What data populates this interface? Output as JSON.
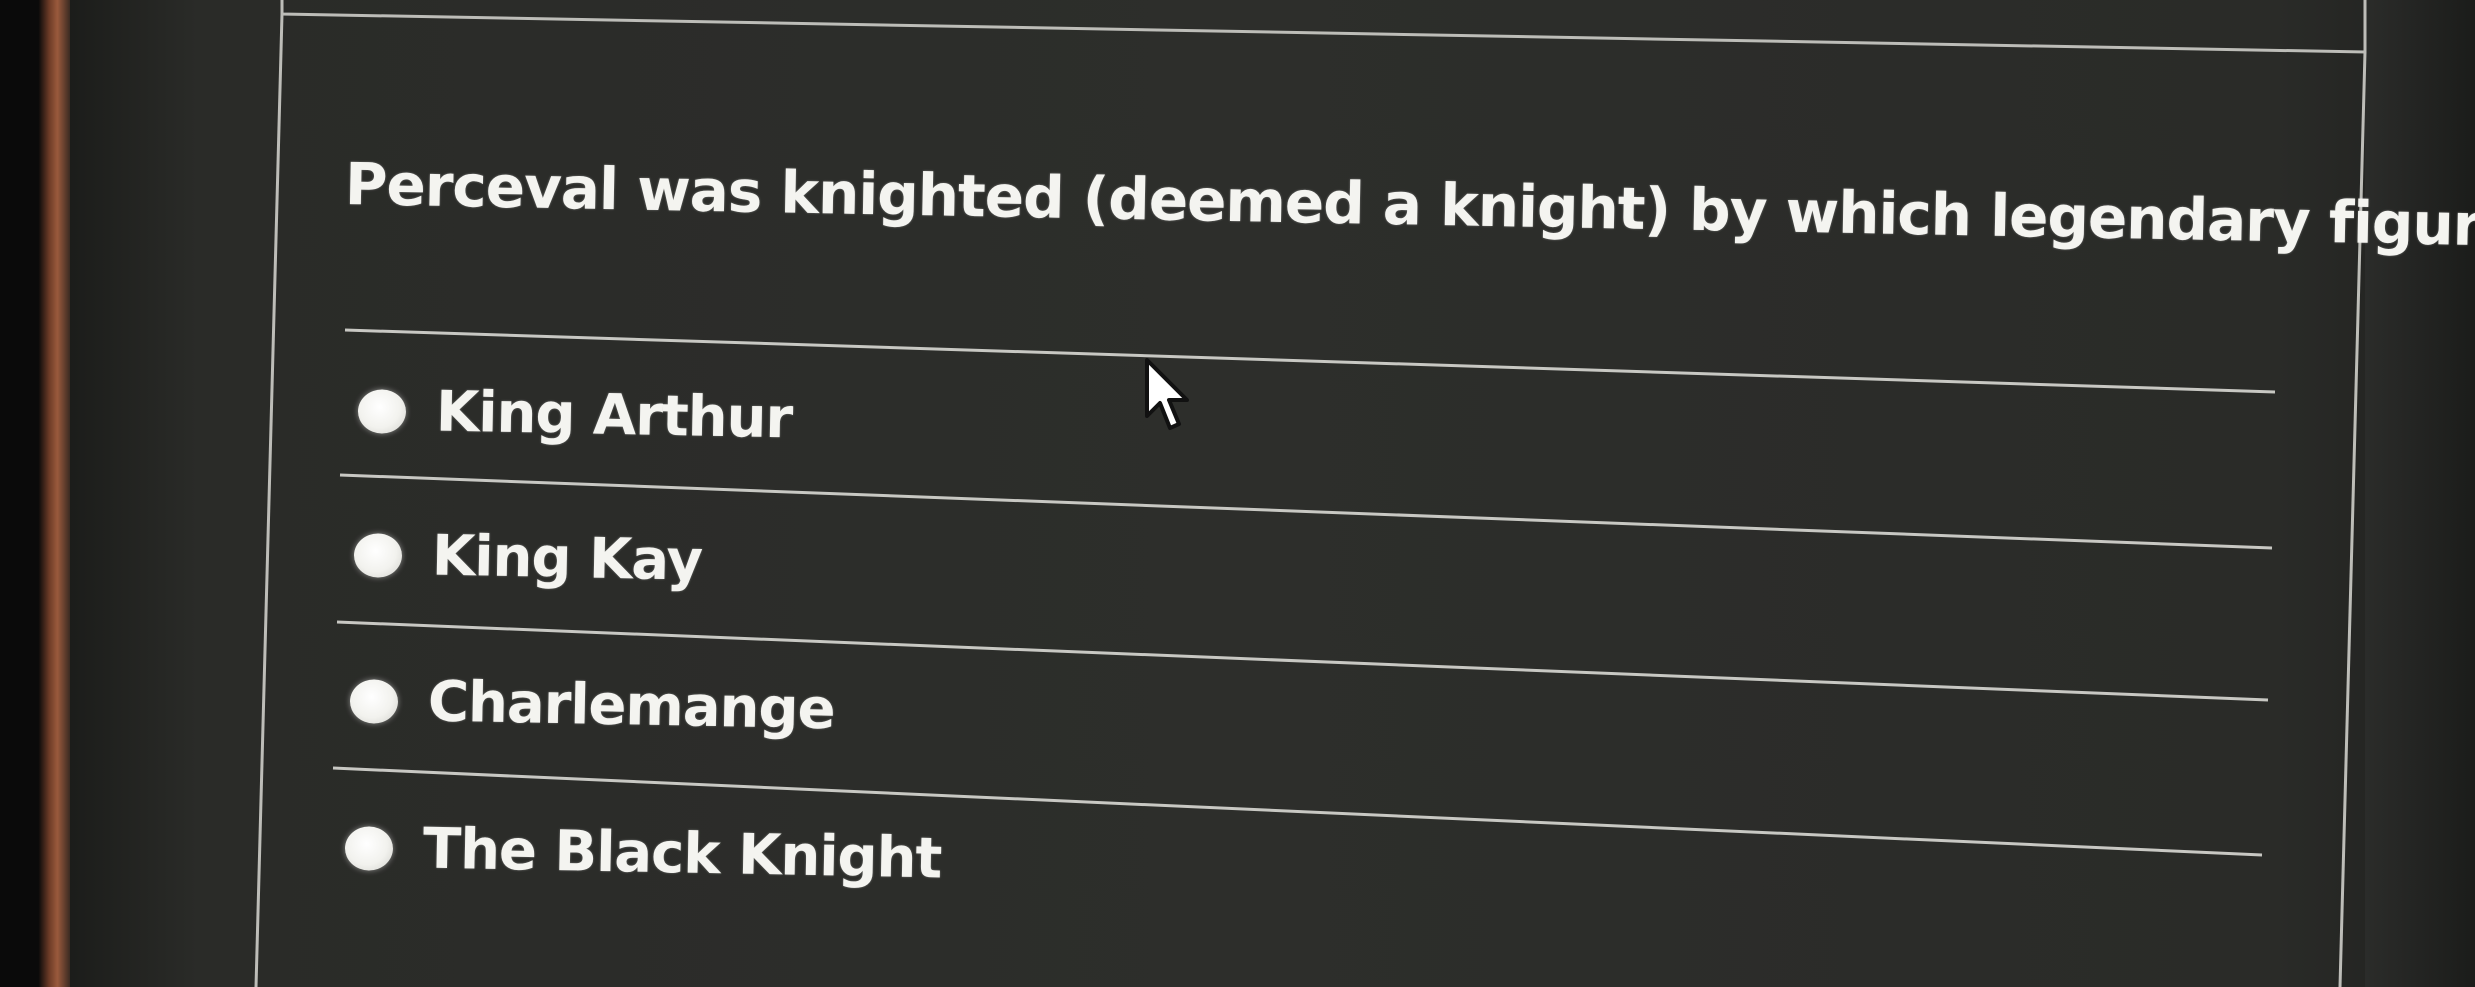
{
  "quiz": {
    "question": "Perceval was knighted (deemed a knight) by which legendary figure?",
    "options": [
      {
        "label": "King Arthur"
      },
      {
        "label": "King Kay"
      },
      {
        "label": "Charlemange"
      },
      {
        "label": "The Black Knight"
      }
    ]
  },
  "colors": {
    "panel_background": "#2d2e2b",
    "border": "#bdbdb8",
    "text": "#f4f4f0",
    "radio_fill": "#f2f2ee"
  },
  "icons": {
    "cursor": "mouse-pointer-icon"
  }
}
